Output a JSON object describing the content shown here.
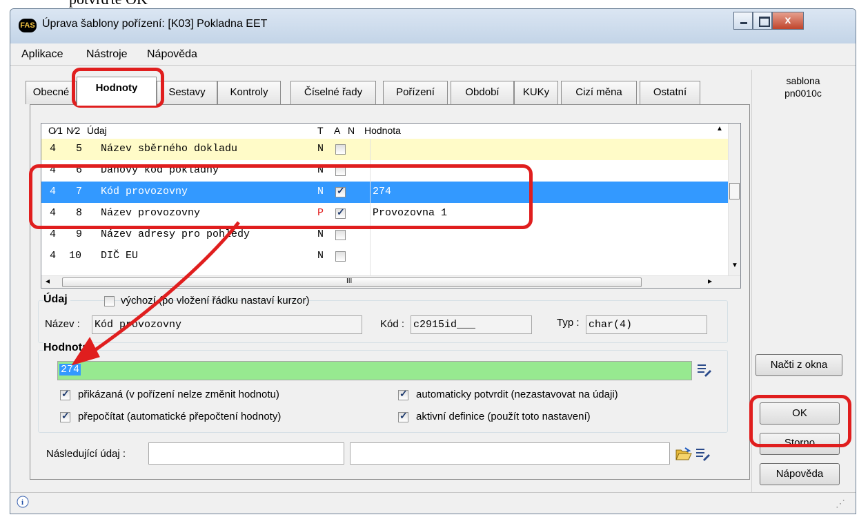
{
  "doc": {
    "text": "potvrďte OK"
  },
  "window": {
    "logo": "FAS",
    "title": "Úprava šablony pořízení: [K03] Pokladna EET",
    "close_label": "x",
    "colors": {
      "selection": "#3399ff",
      "value_bg": "#97e990",
      "highlight_row": "#fffbc8",
      "annotation": "#e01e1e"
    }
  },
  "menu": {
    "items": [
      "Aplikace",
      "Nástroje",
      "Nápověda"
    ]
  },
  "tabs": [
    "Obecné",
    "Hodnoty",
    "Sestavy",
    "Kontroly",
    "Číselné řady",
    "Pořízení",
    "Období",
    "KUKy",
    "Cizí měna",
    "Ostatní"
  ],
  "side": {
    "line1": "sablona",
    "line2": "pn0010c"
  },
  "grid": {
    "headers": {
      "o": "O⁄1",
      "n": "N⁄2",
      "udaj": "Údaj",
      "t": "T",
      "a": "A",
      "nn": "N",
      "hodnota": "Hodnota"
    },
    "rows": [
      {
        "o": "4",
        "n": "5",
        "udaj": "Název sběrného dokladu",
        "t": "N",
        "a": false,
        "hodnota": ""
      },
      {
        "o": "4",
        "n": "6",
        "udaj": "Daňový kód pokladny",
        "t": "N",
        "a": false,
        "hodnota": ""
      },
      {
        "o": "4",
        "n": "7",
        "udaj": "Kód provozovny",
        "t": "N",
        "a": true,
        "hodnota": "274"
      },
      {
        "o": "4",
        "n": "8",
        "udaj": "Název provozovny",
        "t": "P",
        "a": true,
        "hodnota": "Provozovna 1"
      },
      {
        "o": "4",
        "n": "9",
        "udaj": "Název adresy pro pohledy",
        "t": "N",
        "a": false,
        "hodnota": ""
      },
      {
        "o": "4",
        "n": "10",
        "udaj": "DIČ EU",
        "t": "N",
        "a": false,
        "hodnota": ""
      }
    ],
    "hscroll_mark": "III"
  },
  "udaj": {
    "label": "Údaj",
    "vychozi": "výchozí (po vložení řádku nastaví kurzor)",
    "nazev_label": "Název :",
    "nazev_value": "Kód provozovny",
    "kod_label": "Kód :",
    "kod_value": "c2915id___",
    "typ_label": "Typ :",
    "typ_value": "char(4)"
  },
  "hodnota": {
    "label": "Hodnota",
    "value": "274",
    "opt1": "přikázaná (v pořízení nelze změnit hodnotu)",
    "opt2": "přepočítat (automatické přepočtení hodnoty)",
    "opt3": "automaticky potvrdit (nezastavovat na údaji)",
    "opt4": "aktivní definice (použít toto nastavení)"
  },
  "nasledujici": {
    "label": "Následující údaj :"
  },
  "buttons": {
    "nacti": "Načti z okna",
    "ok": "OK",
    "storno": "Storno",
    "napoveda": "Nápověda"
  }
}
